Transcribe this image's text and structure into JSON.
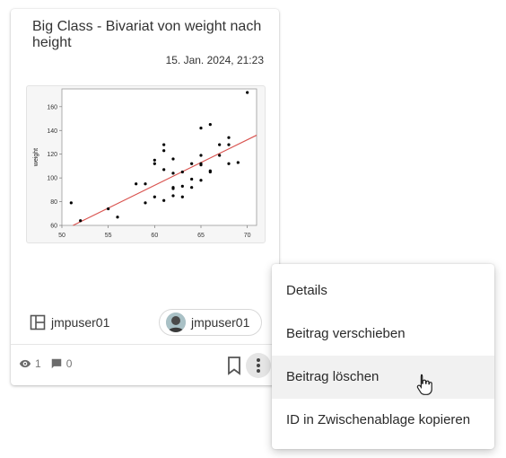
{
  "card": {
    "title": "Big Class - Bivariat von weight nach height",
    "date": "15. Jan. 2024, 21:23",
    "owner": "jmpuser01",
    "user_chip": "jmpuser01",
    "views": "1",
    "comments": "0"
  },
  "chart_data": {
    "type": "scatter",
    "ylabel": "weight",
    "xlim": [
      50,
      71
    ],
    "ylim": [
      60,
      175
    ],
    "x_ticks": [
      "50",
      "55",
      "60",
      "65",
      "70"
    ],
    "y_ticks": [
      "60",
      "80",
      "100",
      "120",
      "140",
      "160"
    ],
    "points": [
      [
        51,
        79
      ],
      [
        52,
        64
      ],
      [
        55,
        74
      ],
      [
        56,
        67
      ],
      [
        58,
        95
      ],
      [
        59,
        79
      ],
      [
        59,
        95
      ],
      [
        60,
        112
      ],
      [
        60,
        115
      ],
      [
        60,
        84
      ],
      [
        61,
        81
      ],
      [
        61,
        107
      ],
      [
        61,
        123
      ],
      [
        61,
        128
      ],
      [
        62,
        85
      ],
      [
        62,
        91
      ],
      [
        62,
        92
      ],
      [
        62,
        104
      ],
      [
        62,
        116
      ],
      [
        63,
        84
      ],
      [
        63,
        93
      ],
      [
        63,
        105
      ],
      [
        64,
        92
      ],
      [
        64,
        99
      ],
      [
        64,
        112
      ],
      [
        65,
        98
      ],
      [
        65,
        111
      ],
      [
        65,
        112
      ],
      [
        65,
        119
      ],
      [
        65,
        142
      ],
      [
        66,
        105
      ],
      [
        66,
        106
      ],
      [
        66,
        145
      ],
      [
        67,
        119
      ],
      [
        67,
        128
      ],
      [
        68,
        112
      ],
      [
        68,
        128
      ],
      [
        68,
        134
      ],
      [
        69,
        113
      ],
      [
        70,
        172
      ]
    ],
    "fit_line": {
      "x": [
        51.2,
        71
      ],
      "y": [
        60,
        136
      ],
      "color": "#d9534f"
    }
  },
  "menu": {
    "items": [
      "Details",
      "Beitrag verschieben",
      "Beitrag löschen",
      "ID in Zwischenablage kopieren"
    ]
  }
}
